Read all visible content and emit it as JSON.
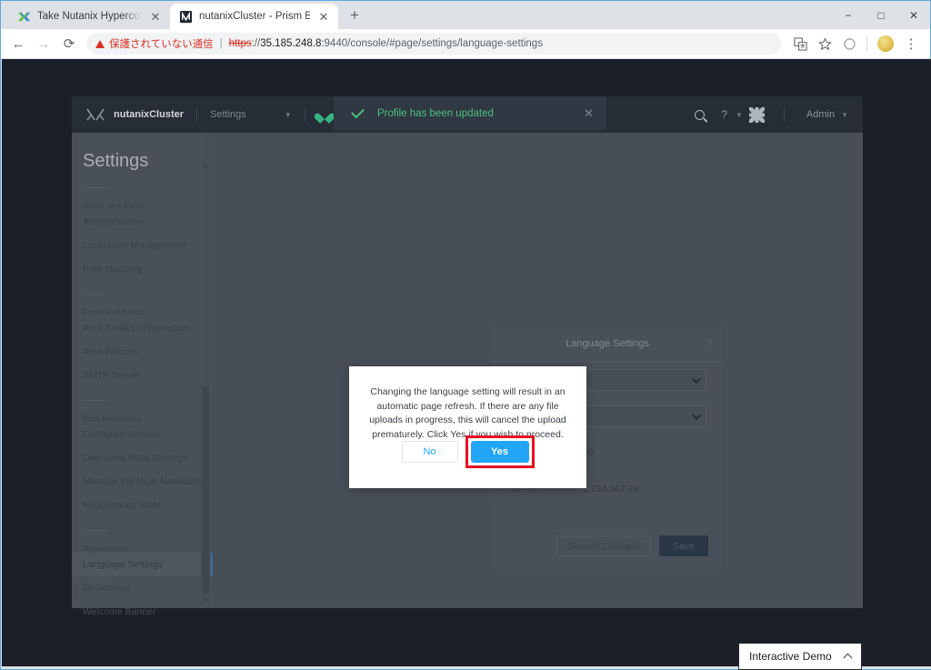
{
  "browser": {
    "tabs": [
      {
        "title": "Take Nutanix Hyperconverged In",
        "favicon": "nutanix-x-icon",
        "active": false
      },
      {
        "title": "nutanixCluster - Prism Element",
        "favicon": "prism-app-icon",
        "active": true
      }
    ],
    "new_tab_label": "+",
    "window_controls": {
      "minimize": "−",
      "maximize": "□",
      "close": "✕"
    },
    "nav": {
      "back": "←",
      "forward": "→",
      "reload": "⟳"
    },
    "omnibox": {
      "security_label": "保護されていない通信",
      "scheme": "https",
      "separator": "://",
      "host": "35.185.248.8",
      "rest": ":9440/console/#page/settings/language-settings"
    },
    "toolbar_icons": [
      "translate-icon",
      "bookmark-star-icon",
      "profile-incognito-icon",
      "avatar-icon",
      "more-menu-icon"
    ]
  },
  "app": {
    "header": {
      "logo": "nutanix-x-logo",
      "cluster_name": "nutanixCluster",
      "nav_item": "Settings",
      "health_icon": "heart-icon",
      "tasks_icon": "circle-icon",
      "search_icon": "search-icon",
      "help_icon": "question-mark-icon",
      "settings_icon": "gear-icon",
      "user_label": "Admin"
    },
    "toast": {
      "message": "Profile has been updated",
      "icon": "checkmark-icon",
      "close": "✕"
    },
    "settings_panel": {
      "title": "Settings",
      "sections": [
        {
          "label": "Users and Roles",
          "items": [
            "Authentication",
            "Local User Management",
            "Role Mapping"
          ]
        },
        {
          "label": "Email and Alerts",
          "items": [
            "Alert Email Configuration",
            "Alert Policies",
            "SMTP Server"
          ]
        },
        {
          "label": "Data Resiliency",
          "items": [
            "Configure Witness",
            "Degraded Node Settings",
            "Manage VM High Availability",
            "Redundancy State"
          ]
        },
        {
          "label": "Appearance",
          "items": [
            "Language Settings",
            "UI Settings",
            "Welcome Banner"
          ]
        }
      ],
      "selected_item": "Language Settings"
    },
    "language_card": {
      "title": "Language Settings",
      "help_icon": "?",
      "rows": [
        {
          "label": "",
          "type": "select",
          "value": ""
        },
        {
          "label": "",
          "type": "select",
          "value": ""
        },
        {
          "label": "",
          "type": "text",
          "value": "00"
        },
        {
          "label": "Number",
          "type": "text",
          "value": "1,234,567.89"
        }
      ],
      "discard_label": "Discard Changes",
      "save_label": "Save"
    },
    "modal": {
      "message": "Changing the language setting will result in an automatic page refresh. If there are any file uploads in progress, this will cancel the upload prematurely. Click Yes if you wish to proceed.",
      "no_label": "No",
      "yes_label": "Yes",
      "highlight_color": "#e81123",
      "primary_color": "#22a5f7"
    }
  },
  "overlay": {
    "demo_label": "Interactive Demo",
    "demo_chevron": "chevron-up-icon"
  }
}
